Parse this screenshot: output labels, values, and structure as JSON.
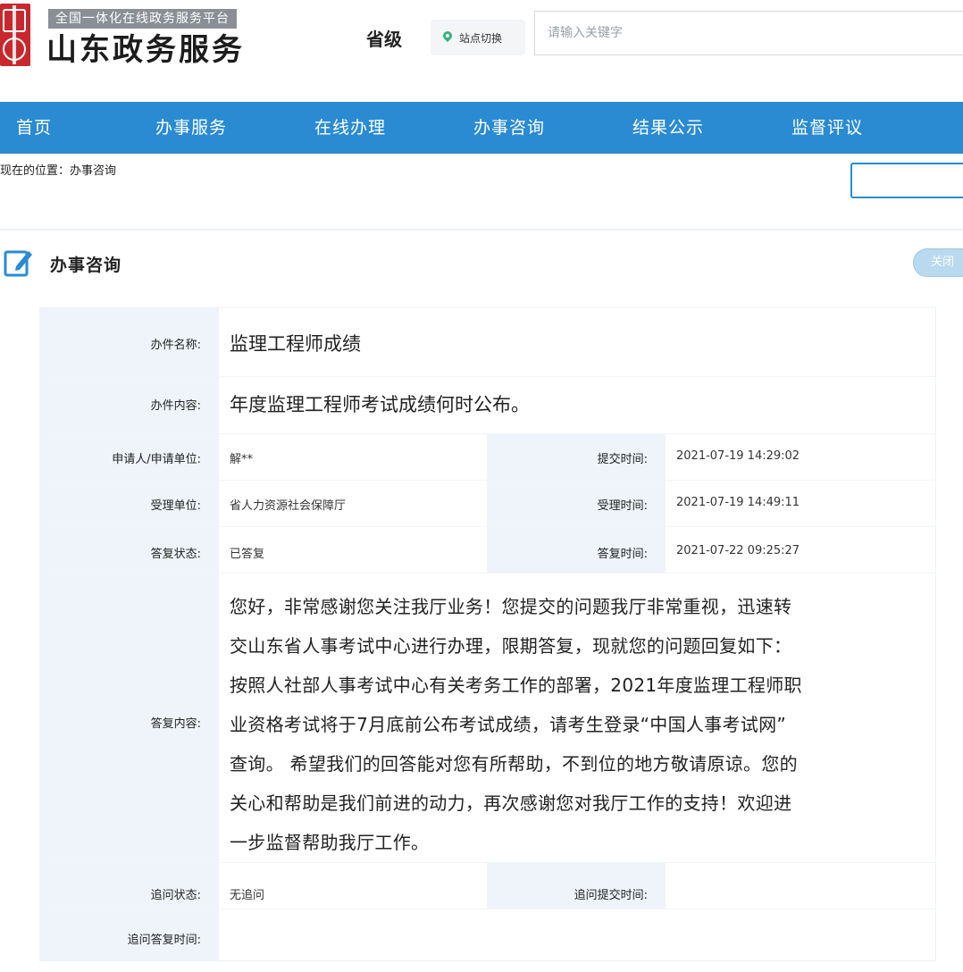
{
  "header": {
    "platform_tag": "全国一体化在线政务服务平台",
    "site_title": "山东政务服务",
    "level": "省级",
    "site_switch": "站点切换",
    "search_placeholder": "请输入关键字"
  },
  "nav": {
    "items": [
      "首页",
      "办事服务",
      "在线办理",
      "办事咨询",
      "结果公示",
      "监督评议"
    ]
  },
  "breadcrumb": {
    "prefix": "现在的位置：",
    "current": "办事咨询"
  },
  "section": {
    "title": "办事咨询",
    "close_label": "关闭"
  },
  "detail": {
    "name_label": "办件名称:",
    "name_value": "监理工程师成绩",
    "content_label": "办件内容:",
    "content_value": "年度监理工程师考试成绩何时公布。",
    "applicant_label": "申请人/申请单位:",
    "applicant_value": "解**",
    "submit_time_label": "提交时间:",
    "submit_time_value": "2021-07-19 14:29:02",
    "accept_unit_label": "受理单位:",
    "accept_unit_value": "省人力资源社会保障厅",
    "accept_time_label": "受理时间:",
    "accept_time_value": "2021-07-19 14:49:11",
    "reply_status_label": "答复状态:",
    "reply_status_value": "已答复",
    "reply_time_label": "答复时间:",
    "reply_time_value": "2021-07-22 09:25:27",
    "reply_content_label": "答复内容:",
    "reply_lines": [
      "您好，非常感谢您关注我厅业务！您提交的问题我厅非常重视，迅速转",
      "交山东省人事考试中心进行办理，限期答复，现就您的问题回复如下：",
      "按照人社部人事考试中心有关考务工作的部署，2021年度监理工程师职",
      "业资格考试将于7月底前公布考试成绩，请考生登录“中国人事考试网”",
      "查询。 希望我们的回答能对您有所帮助，不到位的地方敬请原谅。您的",
      "关心和帮助是我们前进的动力，再次感谢您对我厅工作的支持！欢迎进",
      "一步监督帮助我厅工作。"
    ],
    "followup_status_label": "追问状态:",
    "followup_status_value": "无追问",
    "followup_submit_label": "追问提交时间:",
    "followup_reply_time_label": "追问答复时间:"
  }
}
